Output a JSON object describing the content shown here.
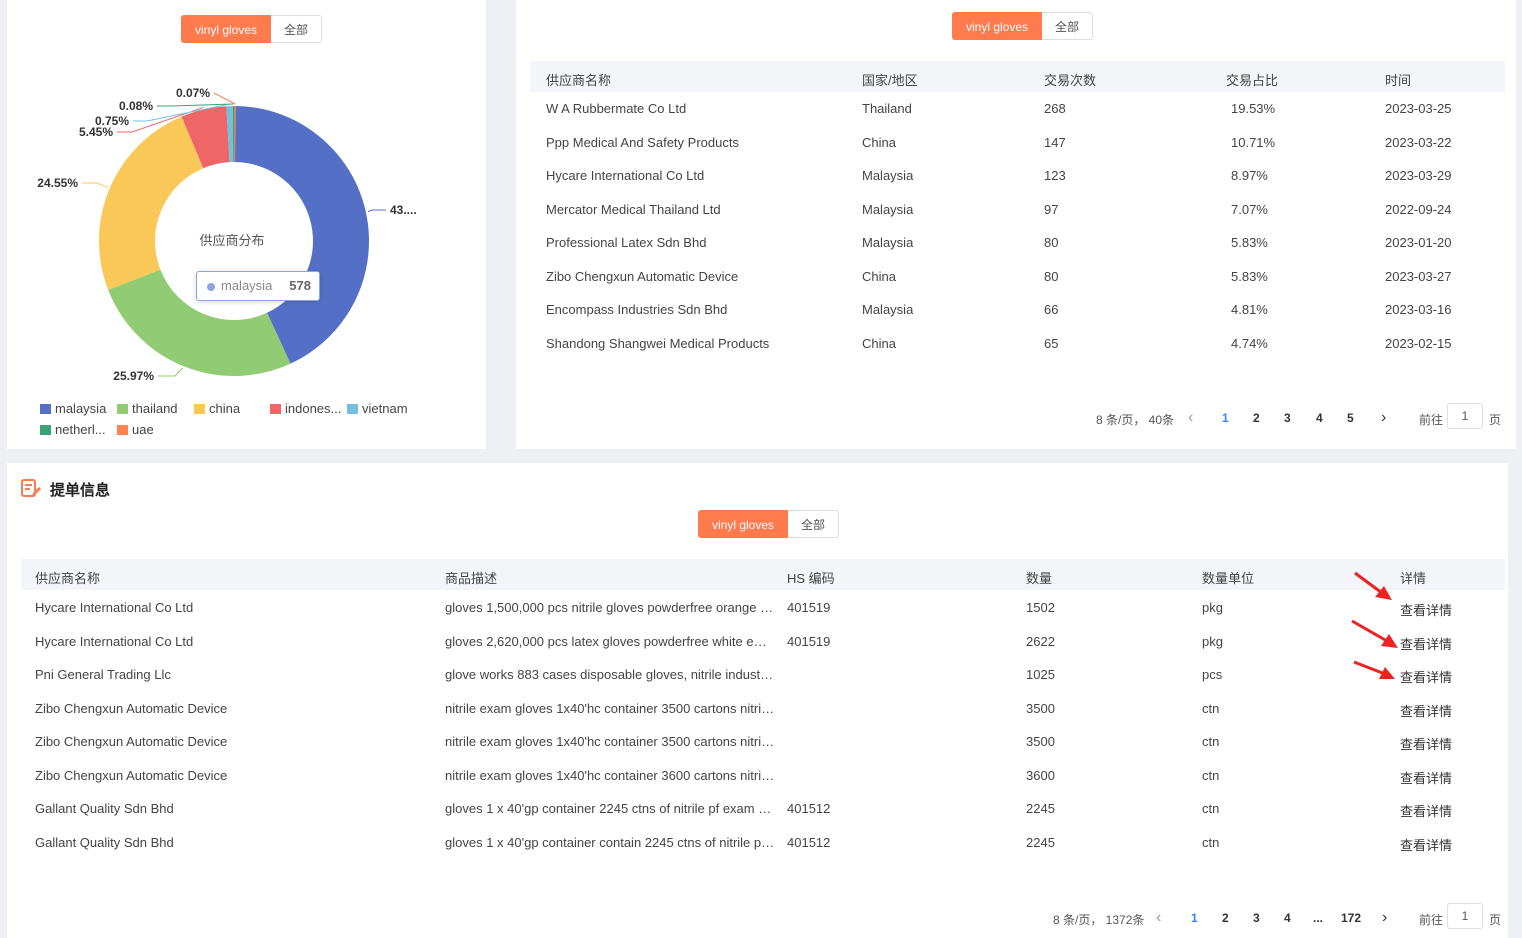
{
  "colors": {
    "accent": "#ff7a4d",
    "pager_active": "#2f86f6",
    "arrow": "#ee2222"
  },
  "chart_panel": {
    "tab_active": "vinyl gloves",
    "tab_all": "全部",
    "center_title": "供应商分布",
    "tooltip": {
      "name": "malaysia",
      "value": "578"
    }
  },
  "chart_data": {
    "type": "pie",
    "variant": "donut",
    "title": "供应商分布",
    "slices": [
      {
        "name": "malaysia",
        "label": "43....",
        "value": 43.13,
        "color": "#5470c6"
      },
      {
        "name": "thailand",
        "label": "25.97%",
        "value": 25.97,
        "color": "#91cc75"
      },
      {
        "name": "china",
        "label": "24.55%",
        "value": 24.55,
        "color": "#fac858"
      },
      {
        "name": "indones...",
        "label": "5.45%",
        "value": 5.45,
        "color": "#ee6666"
      },
      {
        "name": "vietnam",
        "label": "0.75%",
        "value": 0.75,
        "color": "#73c0de"
      },
      {
        "name": "netherl...",
        "label": "0.08%",
        "value": 0.08,
        "color": "#3ba272"
      },
      {
        "name": "uae",
        "label": "0.07%",
        "value": 0.07,
        "color": "#fc8452"
      }
    ],
    "legend_position": "bottom-left"
  },
  "supplier_panel": {
    "tab_active": "vinyl gloves",
    "tab_all": "全部",
    "headers": [
      "供应商名称",
      "国家/地区",
      "交易次数",
      "交易占比",
      "时间"
    ],
    "rows": [
      [
        "W A Rubbermate Co Ltd",
        "Thailand",
        "268",
        "19.53%",
        "2023-03-25"
      ],
      [
        "Ppp Medical And Safety Products",
        "China",
        "147",
        "10.71%",
        "2023-03-22"
      ],
      [
        "Hycare International Co Ltd",
        "Malaysia",
        "123",
        "8.97%",
        "2023-03-29"
      ],
      [
        "Mercator Medical Thailand Ltd",
        "Malaysia",
        "97",
        "7.07%",
        "2022-09-24"
      ],
      [
        "Professional Latex Sdn Bhd",
        "Malaysia",
        "80",
        "5.83%",
        "2023-01-20"
      ],
      [
        "Zibo Chengxun Automatic Device",
        "China",
        "80",
        "5.83%",
        "2023-03-27"
      ],
      [
        "Encompass Industries Sdn Bhd",
        "Malaysia",
        "66",
        "4.81%",
        "2023-03-16"
      ],
      [
        "Shandong Shangwei Medical Products",
        "China",
        "65",
        "4.74%",
        "2023-02-15"
      ]
    ],
    "pager": {
      "summary": "8 条/页，  40条",
      "pages": [
        "1",
        "2",
        "3",
        "4",
        "5"
      ],
      "current": "1",
      "goto_label": "前往",
      "goto_value": "1",
      "page_suffix": "页",
      "prev": "‹",
      "next": "›"
    }
  },
  "bill_panel": {
    "title": "提单信息",
    "tab_active": "vinyl gloves",
    "tab_all": "全部",
    "headers": [
      "供应商名称",
      "商品描述",
      "HS 编码",
      "数量",
      "数量单位",
      "详情"
    ],
    "rows": [
      [
        "Hycare International Co Ltd",
        "gloves 1,500,000 pcs nitrile gloves powderfree orange em...",
        "401519",
        "1502",
        "pkg",
        "查看详情"
      ],
      [
        "Hycare International Co Ltd",
        "gloves 2,620,000 pcs latex gloves powderfree white empty...",
        "401519",
        "2622",
        "pkg",
        "查看详情"
      ],
      [
        "Pni General Trading Llc",
        "glove works 883 cases disposable gloves, nitrile industrial,...",
        "",
        "1025",
        "pcs",
        "查看详情"
      ],
      [
        "Zibo Chengxun Automatic Device",
        "nitrile exam gloves 1x40'hc container 3500 cartons nitrile ...",
        "",
        "3500",
        "ctn",
        "查看详情"
      ],
      [
        "Zibo Chengxun Automatic Device",
        "nitrile exam gloves 1x40'hc container 3500 cartons nitrile ...",
        "",
        "3500",
        "ctn",
        "查看详情"
      ],
      [
        "Zibo Chengxun Automatic Device",
        "nitrile exam gloves 1x40'hc container 3600 cartons nitrile ...",
        "",
        "3600",
        "ctn",
        "查看详情"
      ],
      [
        "Gallant Quality Sdn Bhd",
        "gloves 1 x 40'gp container 2245 ctns of nitrile pf exam glo...",
        "401512",
        "2245",
        "ctn",
        "查看详情"
      ],
      [
        "Gallant Quality Sdn Bhd",
        "gloves 1 x 40'gp container contain 2245 ctns of nitrile pf e...",
        "401512",
        "2245",
        "ctn",
        "查看详情"
      ]
    ],
    "pager": {
      "summary": "8 条/页，  1372条",
      "pages": [
        "1",
        "2",
        "3",
        "4",
        "...",
        "172"
      ],
      "current": "1",
      "goto_label": "前往",
      "goto_value": "1",
      "page_suffix": "页",
      "prev": "‹",
      "next": "›"
    }
  }
}
